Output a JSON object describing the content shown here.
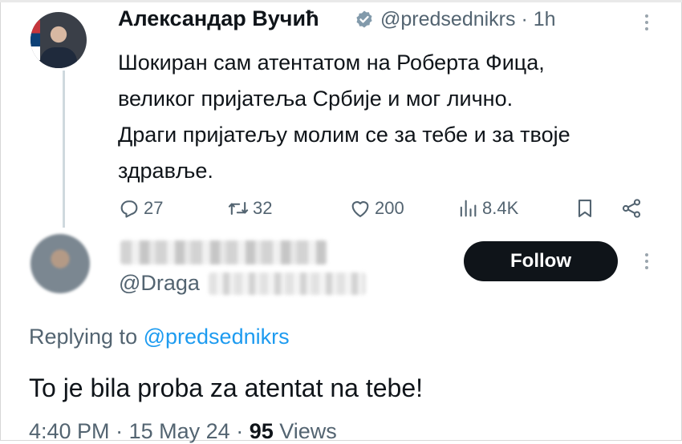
{
  "tweet": {
    "author_name": "Александар Вучић",
    "handle": "@predsednikrs",
    "separator": "·",
    "time": "1h",
    "text": "Шокиран сам атентатом на Роберта Фица,\nвеликог пријатеља Србије и мог лично.\nДраги пријатељу молим се за тебе и за твоје\nздравље.",
    "replies": "27",
    "reposts": "32",
    "likes": "200",
    "views": "8.4K"
  },
  "reply": {
    "handle_visible": "@Draga",
    "follow_label": "Follow",
    "replying_prefix": "Replying to",
    "replying_mention": "@predsednikrs",
    "text": "To je bila proba za atentat na tebe!",
    "time": "4:40 PM",
    "date": "15 May 24",
    "view_count": "95",
    "views_label": "Views",
    "separator": "·"
  },
  "colors": {
    "verified_badge": "#829aab",
    "link": "#1d9bf0",
    "muted_text": "#536471",
    "follow_button": "#0f1419"
  },
  "icons": [
    "verified-icon",
    "more-icon",
    "reply-icon",
    "repost-icon",
    "like-icon",
    "views-icon",
    "bookmark-icon",
    "share-icon"
  ]
}
